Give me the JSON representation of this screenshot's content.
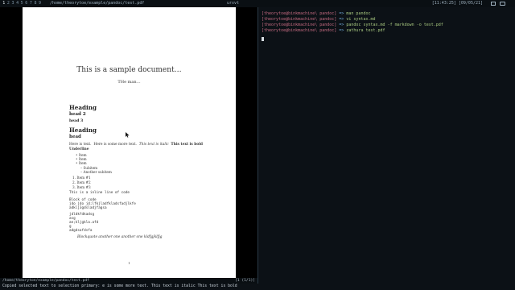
{
  "topbar": {
    "workspaces": [
      "1",
      "2",
      "3",
      "4",
      "5",
      "6",
      "7",
      "8",
      "9"
    ],
    "active_workspace": 0,
    "window_title": "/home/theorytoe/example/pandoc/test.pdf",
    "center_label": "urxvt",
    "time": "[11:43:25]",
    "date": "[09/05/21]"
  },
  "document": {
    "title": "This is a sample document…",
    "author": "THe man…",
    "headings": [
      "Heading",
      "head 2",
      "head 3",
      "Heading",
      "head"
    ],
    "paragraph_plain": "Here is text.",
    "paragraph_more": "Here is some more text.",
    "paragraph_italic": "This text is italic",
    "paragraph_bold": "This text is bold",
    "underline": "Underline",
    "bullets": [
      "Item",
      "Item",
      "Item"
    ],
    "subitems": [
      "Subitem",
      "Another subitem"
    ],
    "numbered": [
      "1.  Item #1",
      "2.  Item #2",
      "3.  Item #3"
    ],
    "inline_code": "This is a inline line of code",
    "code_block": [
      "Block of code",
      "jdo jdo jd;lfkjladfkladsfadjlkfe",
      "adklj3gdsladjfagsa"
    ],
    "code_block2": [
      "jdldkfdkadsg",
      "asg",
      "ae;kljgkla.afd",
      "g",
      "adgdsafdsfa"
    ],
    "blockquote": "Blockquote another one another one kldfgjklfjg",
    "page_number": "1"
  },
  "status": {
    "file": "/home/theorytoe/example/pandoc/test.pdf",
    "page_counter": "[1 (1/1)]"
  },
  "message": "Copied selected text to selection primary: e is some more text. This text is italic This text is bold",
  "terminal": {
    "lines": [
      {
        "prompt": "[theorytoe@binkmachine\\ pandoc]",
        "cmd": "man pandoc"
      },
      {
        "prompt": "[theorytoe@binkmachine\\ pandoc]",
        "cmd": "vi syntax.md"
      },
      {
        "prompt": "[theorytoe@binkmachine\\ pandoc]",
        "cmd": "pandoc syntax.md -f markdown -o test.pdf"
      },
      {
        "prompt": "[theorytoe@binkmachine\\ pandoc]",
        "cmd": "zathura test.pdf"
      }
    ],
    "arrow": "=>"
  }
}
